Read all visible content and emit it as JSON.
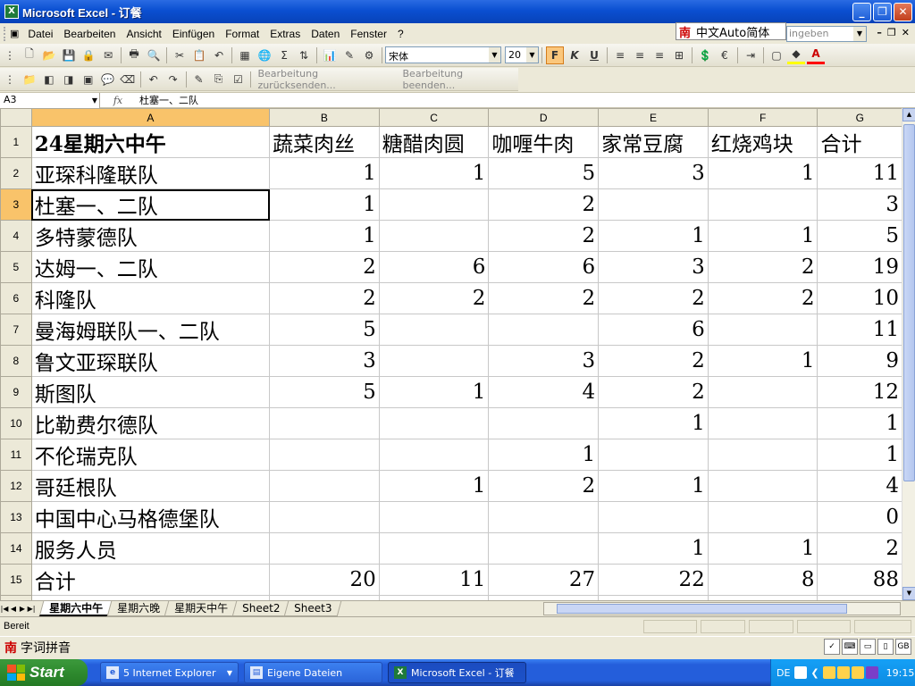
{
  "window": {
    "title": "Microsoft Excel - 订餐",
    "app_icon": "X"
  },
  "menubar": {
    "items": [
      "Datei",
      "Bearbeiten",
      "Ansicht",
      "Einfügen",
      "Format",
      "Extras",
      "Daten",
      "Fenster",
      "?"
    ]
  },
  "ime_float": {
    "label": "中文Auto简体"
  },
  "helpbox": {
    "text": "ingeben"
  },
  "toolbar": {
    "font_name": "宋体",
    "font_size": "20",
    "bold": "F",
    "italic": "K",
    "underline": "U",
    "euro": "€",
    "sigma": "Σ"
  },
  "reviewbar": {
    "reply_label": "Bearbeitung zurücksenden...",
    "end_label": "Bearbeitung beenden..."
  },
  "formulabar": {
    "cell_ref": "A3",
    "fx": "fx",
    "content": "杜塞一、二队"
  },
  "sheet": {
    "col_headers": [
      "A",
      "B",
      "C",
      "D",
      "E",
      "F",
      "G"
    ],
    "rows": [
      {
        "n": "1",
        "cells": [
          "24星期六中午",
          "蔬菜肉丝",
          "糖醋肉圆",
          "咖喱牛肉",
          "家常豆腐",
          "红烧鸡块",
          "合计"
        ]
      },
      {
        "n": "2",
        "cells": [
          "亚琛科隆联队",
          "1",
          "1",
          "5",
          "3",
          "1",
          "11"
        ]
      },
      {
        "n": "3",
        "cells": [
          "杜塞一、二队",
          "1",
          "",
          "2",
          "",
          "",
          "3"
        ]
      },
      {
        "n": "4",
        "cells": [
          "多特蒙德队",
          "1",
          "",
          "2",
          "1",
          "1",
          "5"
        ]
      },
      {
        "n": "5",
        "cells": [
          "达姆一、二队",
          "2",
          "6",
          "6",
          "3",
          "2",
          "19"
        ]
      },
      {
        "n": "6",
        "cells": [
          "科隆队",
          "2",
          "2",
          "2",
          "2",
          "2",
          "10"
        ]
      },
      {
        "n": "7",
        "cells": [
          "曼海姆联队一、二队",
          "5",
          "",
          "",
          "6",
          "",
          "11"
        ]
      },
      {
        "n": "8",
        "cells": [
          "鲁文亚琛联队",
          "3",
          "",
          "3",
          "2",
          "1",
          "9"
        ]
      },
      {
        "n": "9",
        "cells": [
          "斯图队",
          "5",
          "1",
          "4",
          "2",
          "",
          "12"
        ]
      },
      {
        "n": "10",
        "cells": [
          "比勒费尔德队",
          "",
          "",
          "",
          "1",
          "",
          "1"
        ]
      },
      {
        "n": "11",
        "cells": [
          "不伦瑞克队",
          "",
          "",
          "1",
          "",
          "",
          "1"
        ]
      },
      {
        "n": "12",
        "cells": [
          "哥廷根队",
          "",
          "1",
          "2",
          "1",
          "",
          "4"
        ]
      },
      {
        "n": "13",
        "cells": [
          "中国中心马格德堡队",
          "",
          "",
          "",
          "",
          "",
          "0"
        ]
      },
      {
        "n": "14",
        "cells": [
          "服务人员",
          "",
          "",
          "",
          "1",
          "1",
          "2"
        ]
      },
      {
        "n": "15",
        "cells": [
          "合计",
          "20",
          "11",
          "27",
          "22",
          "8",
          "88"
        ]
      },
      {
        "n": "16",
        "cells": [
          "",
          "",
          "",
          "",
          "",
          "",
          ""
        ]
      }
    ]
  },
  "tabs": [
    "星期六中午",
    "星期六晚",
    "星期天中午",
    "Sheet2",
    "Sheet3"
  ],
  "status": {
    "text": "Bereit"
  },
  "imebar": {
    "label": "字词拼音"
  },
  "taskbar": {
    "start": "Start",
    "items": [
      "5 Internet Explorer",
      "Eigene Dateien",
      "Microsoft Excel - 订餐"
    ],
    "lang": "DE",
    "clock": "19:15"
  }
}
